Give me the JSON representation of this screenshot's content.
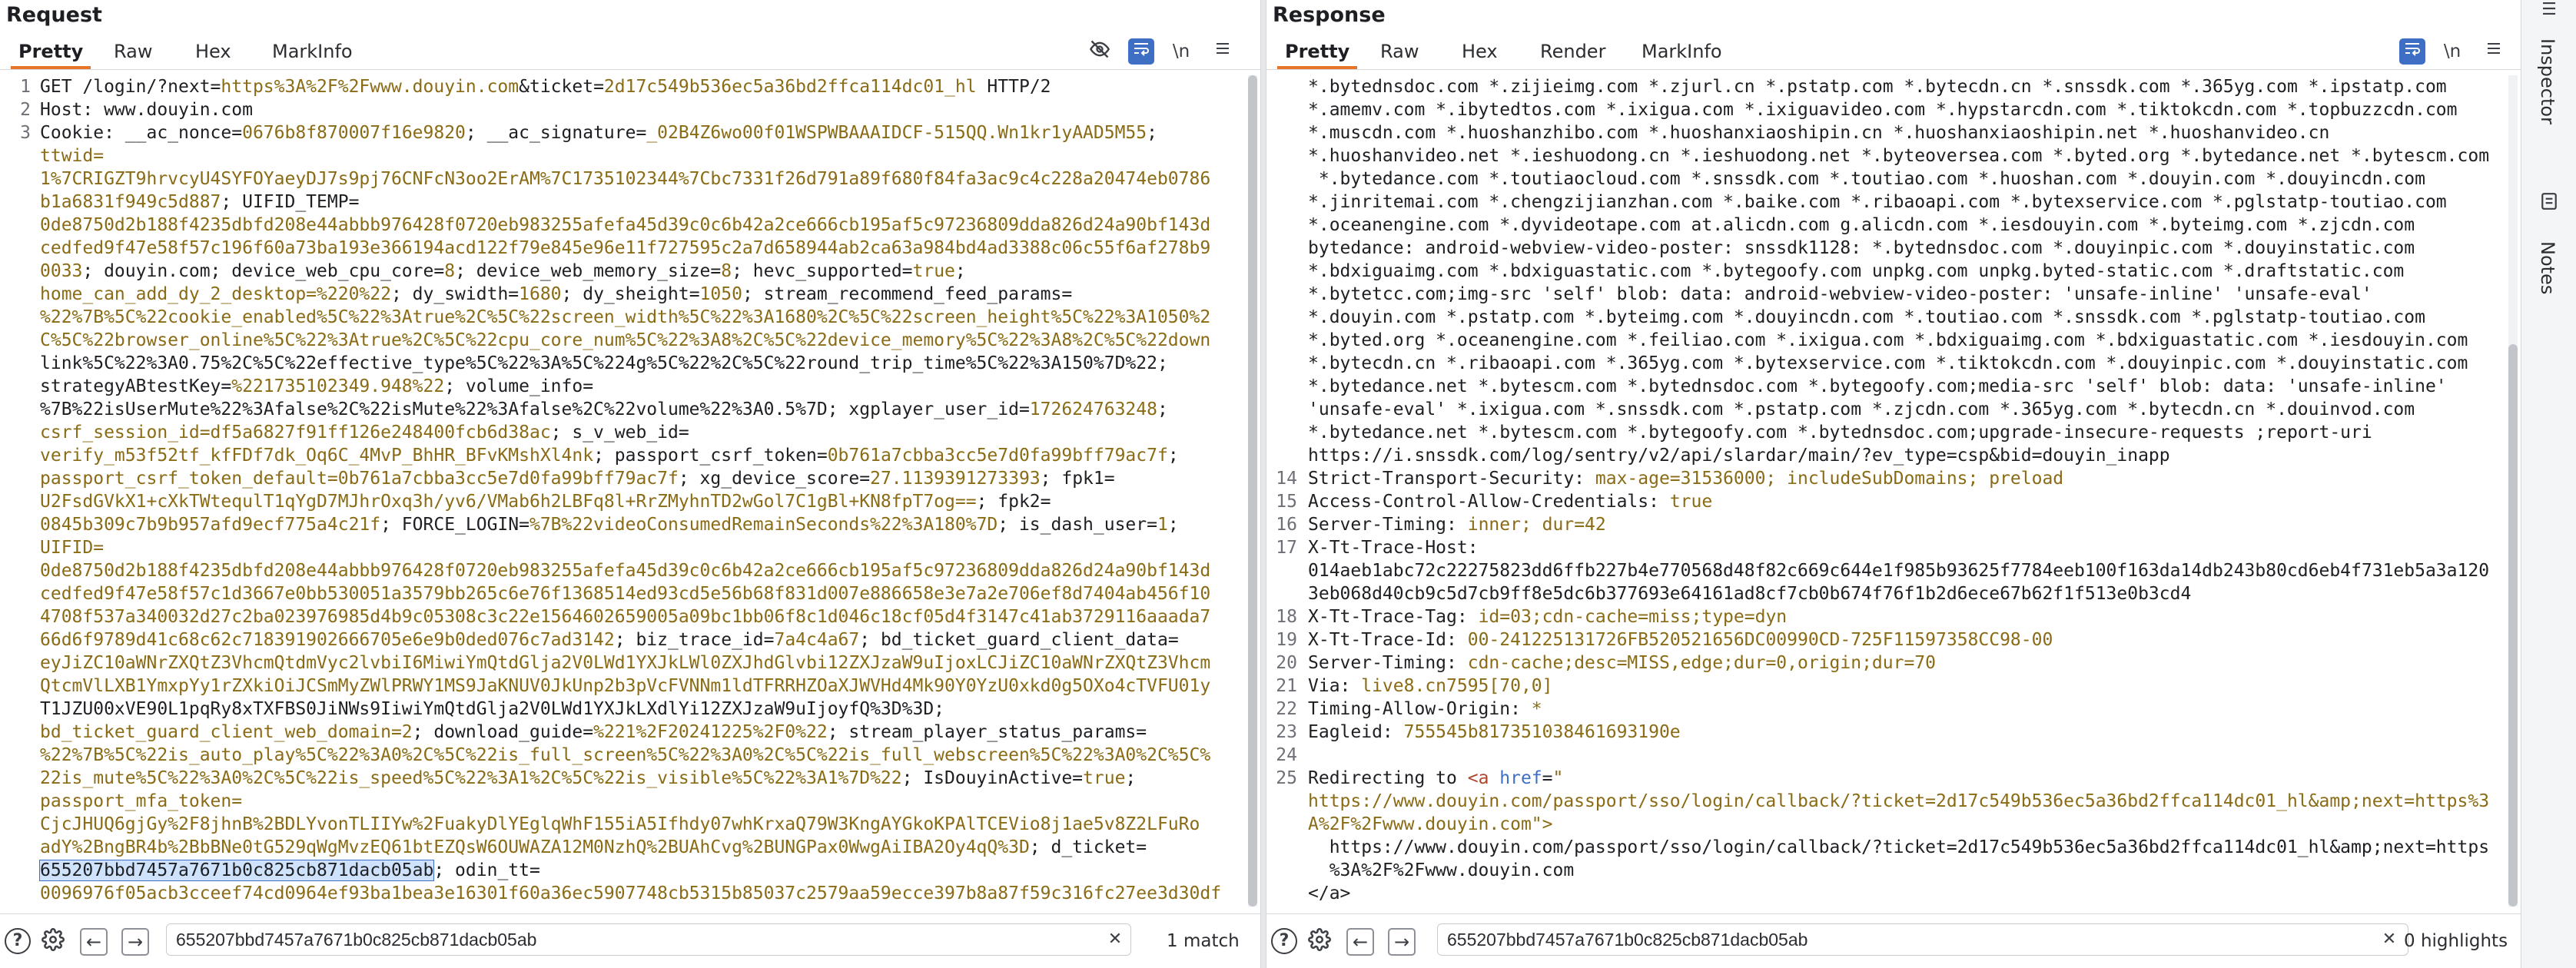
{
  "request": {
    "title": "Request",
    "tabs": [
      "Pretty",
      "Raw",
      "Hex",
      "MarkInfo"
    ],
    "icons": [
      "eye-off-icon",
      "wrap-icon",
      "newline-icon",
      "menu-icon"
    ],
    "newline_label": "\\n",
    "line_numbers": [
      "1",
      "2",
      "3",
      "",
      "",
      "",
      "",
      "",
      "",
      "",
      "",
      "",
      "",
      "",
      "",
      "",
      "",
      "",
      "",
      "",
      "",
      "",
      "",
      "",
      "",
      "",
      "",
      "",
      "",
      "",
      "",
      "",
      "",
      "",
      "",
      ""
    ],
    "lines": [
      "GET /login/?next=https%3A%2F%2Fwww.douyin.com&ticket=2d17c549b536ec5a36bd2ffca114dc01_hl HTTP/2",
      "Host: www.douyin.com",
      "Cookie: __ac_nonce=0676b8f870007f16e9820; __ac_signature=_02B4Z6wo00f01WSPWBAAAIDCF-515QQ.Wn1kr1yAAD5M55;",
      "ttwid=",
      "1%7CRIGZT9hrvcyU4SYFOYaeyDJ7s9pj76CNFcN3oo2ErAM%7C1735102344%7Cbc7331f26d791a89f680f84fa3ac9c4c228a20474eb0786",
      "b1a6831f949c5d887; UIFID_TEMP=",
      "0de8750d2b188f4235dbfd208e44abbb976428f0720eb983255afefa45d39c0c6b42a2ce666cb195af5c97236809dda826d24a90bf143d",
      "cedfed9f47e58f57c196f60a73ba193e366194acd122f79e845e96e11f727595c2a7d658944ab2ca63a984bd4ad3388c06c55f6af278b9",
      "0033; douyin.com; device_web_cpu_core=8; device_web_memory_size=8; hevc_supported=true;",
      "home_can_add_dy_2_desktop=%220%22; dy_swidth=1680; dy_sheight=1050; stream_recommend_feed_params=",
      "%22%7B%5C%22cookie_enabled%5C%22%3Atrue%2C%5C%22screen_width%5C%22%3A1680%2C%5C%22screen_height%5C%22%3A1050%2",
      "C%5C%22browser_online%5C%22%3Atrue%2C%5C%22cpu_core_num%5C%22%3A8%2C%5C%22device_memory%5C%22%3A8%2C%5C%22down",
      "link%5C%22%3A0.75%2C%5C%22effective_type%5C%22%3A%5C%224g%5C%22%2C%5C%22round_trip_time%5C%22%3A150%7D%22;",
      "strategyABtestKey=%221735102349.948%22; volume_info=",
      "%7B%22isUserMute%22%3Afalse%2C%22isMute%22%3Afalse%2C%22volume%22%3A0.5%7D; xgplayer_user_id=172624763248;",
      "csrf_session_id=df5a6827f91ff126e248400fcb6d38ac; s_v_web_id=",
      "verify_m53f52tf_kfFDf7dk_Oq6C_4MvP_BhHR_BFvKMshXl4nk; passport_csrf_token=0b761a7cbba3cc5e7d0fa99bff79ac7f;",
      "passport_csrf_token_default=0b761a7cbba3cc5e7d0fa99bff79ac7f; xg_device_score=27.1139391273393; fpk1=",
      "U2FsdGVkX1+cXkTWtequlT1qYgD7MJhrOxq3h/yv6/VMab6h2LBFq8l+RrZMyhnTD2wGol7C1gBl+KN8fpT7og==; fpk2=",
      "0845b309c7b9b957afd9ecf775a4c21f; FORCE_LOGIN=%7B%22videoConsumedRemainSeconds%22%3A180%7D; is_dash_user=1;",
      "UIFID=",
      "0de8750d2b188f4235dbfd208e44abbb976428f0720eb983255afefa45d39c0c6b42a2ce666cb195af5c97236809dda826d24a90bf143d",
      "cedfed9f47e58f57c1d3667e0bb530051a3579bb265c6e76f1368514ed93cd5e56b68f831d007e886658e3e7a2e706ef8d7404ab456f10",
      "4708f537a340032d27c2ba023976985d4b9c05308c3c22e1564602659005a09bc1bb06f8c1d046c18cf05d4f3147c41ab3729116aaada7",
      "66d6f9789d41c68c62c718391902666705e6e9b0ded076c7ad3142; biz_trace_id=7a4c4a67; bd_ticket_guard_client_data=",
      "eyJiZC10aWNrZXQtZ3VhcmQtdmVyc2lvbiI6MiwiYmQtdGlja2V0LWd1YXJkLWl0ZXJhdGlvbi12ZXJzaW9uIjoxLCJiZC10aWNrZXQtZ3Vhcm",
      "QtcmVlLXB1YmxpYy1rZXkiOiJCSmMyZWlPRWY1MS9JaKNUV0JkUnp2b3pVcFVNNm1ldTFRRHZOaXJWVHd4Mk90Y0YzU0xkd0g5OXo4cTVFU01y",
      "T1JZU00xVE90L1pqRy8xTXFBS0JiNWs9IiwiYmQtdGlja2V0LWd1YXJkLXdlYi12ZXJzaW9uIjoyfQ%3D%3D;",
      "bd_ticket_guard_client_web_domain=2; download_guide=%221%2F20241225%2F0%22; stream_player_status_params=",
      "%22%7B%5C%22is_auto_play%5C%22%3A0%2C%5C%22is_full_screen%5C%22%3A0%2C%5C%22is_full_webscreen%5C%22%3A0%2C%5C%",
      "22is_mute%5C%22%3A0%2C%5C%22is_speed%5C%22%3A1%2C%5C%22is_visible%5C%22%3A1%7D%22; IsDouyinActive=true;",
      "passport_mfa_token=",
      "CjcJHUQ6gjGy%2F8jhnB%2BDLYvonTLIIYw%2FuakyDlYEglqWhF155iA5Ifhdy07whKrxaQ79W3KngAYGkoKPAlTCEVio8j1ae5v8Z2LFuRo",
      "adY%2BngBR4b%2BbBNe0tG529qWgMvzEQ61btEZQsW6OUWAZA12M0NzhQ%2BUAhCvg%2BUNGPax0WwgAiIBA2Oy4qQ%3D; d_ticket=",
      "655207bbd7457a7671b0c825cb871dacb05ab; odin_tt=",
      "0096976f05acb3cceef74cd0964ef93ba1bea3e16301f60a36ec5907748cb5315b85037c2579aa59ecce397b8a87f59c316fc27ee3d30df"
    ],
    "search": {
      "value": "655207bbd7457a7671b0c825cb871dacb05ab",
      "matches": "1 match"
    }
  },
  "response": {
    "title": "Response",
    "tabs": [
      "Pretty",
      "Raw",
      "Hex",
      "Render",
      "MarkInfo"
    ],
    "newline_label": "\\n",
    "line_numbers": [
      "",
      "",
      "",
      "",
      "",
      "",
      "",
      "",
      "",
      "",
      "",
      "",
      "",
      "",
      "",
      "",
      "",
      "14",
      "15",
      "16",
      "17",
      "",
      "",
      "18",
      "19",
      "20",
      "21",
      "22",
      "23",
      "24",
      "25",
      "",
      "",
      "",
      "",
      ""
    ],
    "lines": [
      "*.bytednsdoc.com *.zijieimg.com *.zjurl.cn *.pstatp.com *.bytecdn.cn *.snssdk.com *.365yg.com *.ipstatp.com",
      "*.amemv.com *.ibytedtos.com *.ixigua.com *.ixiguavideo.com *.hypstarcdn.com *.tiktokcdn.com *.topbuzzcdn.com",
      "*.muscdn.com *.huoshanzhibo.com *.huoshanxiaoshipin.cn *.huoshanxiaoshipin.net *.huoshanvideo.cn",
      "*.huoshanvideo.net *.ieshuodong.cn *.ieshuodong.net *.byteoversea.com *.byted.org *.bytedance.net *.bytescm.com",
      " *.bytedance.com *.toutiaocloud.com *.snssdk.com *.toutiao.com *.huoshan.com *.douyin.com *.douyincdn.com",
      "*.jinritemai.com *.chengzijianzhan.com *.baike.com *.ribaoapi.com *.bytexservice.com *.pglstatp-toutiao.com",
      "*.oceanengine.com *.dyvideotape.com at.alicdn.com g.alicdn.com *.iesdouyin.com *.byteimg.com *.zjcdn.com",
      "bytedance: android-webview-video-poster: snssdk1128: *.bytednsdoc.com *.douyinpic.com *.douyinstatic.com",
      "*.bdxiguaimg.com *.bdxiguastatic.com *.bytegoofy.com unpkg.com unpkg.byted-static.com *.draftstatic.com",
      "*.bytetcc.com;img-src 'self' blob: data: android-webview-video-poster: 'unsafe-inline' 'unsafe-eval'",
      "*.douyin.com *.pstatp.com *.byteimg.com *.douyincdn.com *.toutiao.com *.snssdk.com *.pglstatp-toutiao.com",
      "*.byted.org *.oceanengine.com *.feiliao.com *.ixigua.com *.bdxiguaimg.com *.bdxiguastatic.com *.iesdouyin.com",
      "*.bytecdn.cn *.ribaoapi.com *.365yg.com *.bytexservice.com *.tiktokcdn.com *.douyinpic.com *.douyinstatic.com",
      "*.bytedance.net *.bytescm.com *.bytednsdoc.com *.bytegoofy.com;media-src 'self' blob: data: 'unsafe-inline'",
      "'unsafe-eval' *.ixigua.com *.snssdk.com *.pstatp.com *.zjcdn.com *.365yg.com *.bytecdn.cn *.douinvod.com",
      "*.bytedance.net *.bytescm.com *.bytegoofy.com *.bytednsdoc.com;upgrade-insecure-requests ;report-uri",
      "https://i.snssdk.com/log/sentry/v2/api/slardar/main/?ev_type=csp&bid=douyin_inapp",
      "Strict-Transport-Security: max-age=31536000; includeSubDomains; preload",
      "Access-Control-Allow-Credentials: true",
      "Server-Timing: inner; dur=42",
      "X-Tt-Trace-Host:",
      "014aeb1abc72c22275823dd6ffb227b4e770568d48f82c669c644e1f985b93625f7784eeb100f163da14db243b80cd6eb4f731eb5a3a120",
      "3eb068d40cb9c5d7cb9ff8e5dc6b377693e64161ad8cf7cb0b674f76f1b2d6ece67b62f1f513e0b3cd4",
      "X-Tt-Trace-Tag: id=03;cdn-cache=miss;type=dyn",
      "X-Tt-Trace-Id: 00-241225131726FB520521656DC00990CD-725F11597358CC98-00",
      "Server-Timing: cdn-cache;desc=MISS,edge;dur=0,origin;dur=70",
      "Via: live8.cn7595[70,0]",
      "Timing-Allow-Origin: *",
      "Eagleid: 755545b817351038461693190e",
      "",
      "Redirecting to <a href=\"",
      "https://www.douyin.com/passport/sso/login/callback/?ticket=2d17c549b536ec5a36bd2ffca114dc01_hl&amp;next=https%3",
      "A%2F%2Fwww.douyin.com\">",
      "  https://www.douyin.com/passport/sso/login/callback/?ticket=2d17c549b536ec5a36bd2ffca114dc01_hl&amp;next=https",
      "  %3A%2F%2Fwww.douyin.com",
      "</a>",
      "."
    ],
    "search": {
      "value": "655207bbd7457a7671b0c825cb871dacb05ab",
      "matches": "0 highlights"
    }
  },
  "sidebar": {
    "tabs": [
      "Inspector",
      "Notes"
    ]
  },
  "colors": {
    "accent": "#e8742a",
    "selected_icon_bg": "#3f6fc5",
    "value_text": "#8a6b16"
  }
}
